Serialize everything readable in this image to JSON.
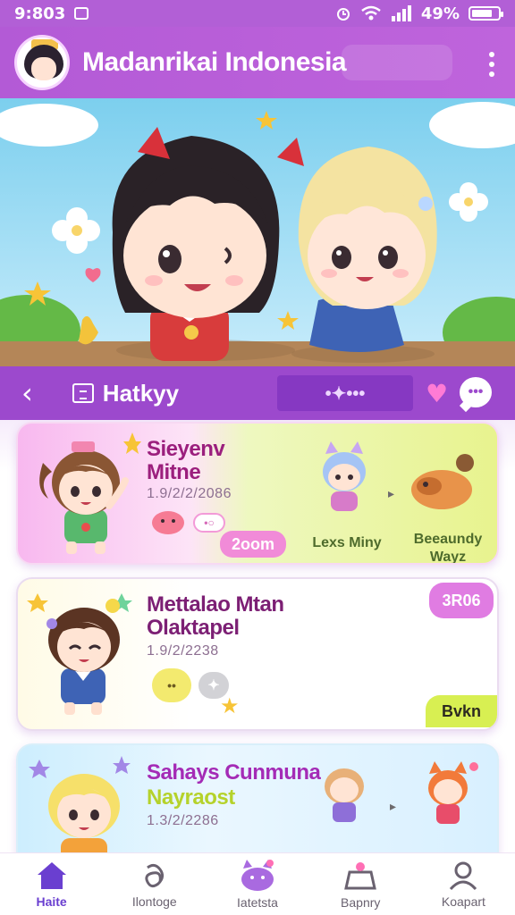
{
  "status_bar": {
    "time": "9:803",
    "battery": "49%"
  },
  "header": {
    "title": "Madanrikai Indonesia"
  },
  "nav_strip": {
    "back_icon": "chevron-left-icon",
    "tab_label": "Hatkyy",
    "pill_text": "•✦•••"
  },
  "cards": [
    {
      "title_line1": "Sieyenv",
      "title_line2": "Mitne",
      "date": "1.9/2/2/2086",
      "pill": "2oom",
      "item_a_label": "Lexs Miny",
      "item_b_label_line1": "Beeaundy",
      "item_b_label_line2": "Wayz"
    },
    {
      "title_line1": "Mettalao Mtan",
      "title_line2": "Olaktapel",
      "date": "1.9/2/2238",
      "badge": "3R06",
      "pill": "Bvkn"
    },
    {
      "title_line1": "Sahays Cunmuna",
      "title_line2": "Nayraost",
      "date": "1.3/2/2286"
    }
  ],
  "bottom_nav": [
    {
      "label": "Haite",
      "icon": "home-icon"
    },
    {
      "label": "Ilontoge",
      "icon": "loop-icon"
    },
    {
      "label": "Iatetsta",
      "icon": "cat-icon"
    },
    {
      "label": "Bapnry",
      "icon": "gift-icon"
    },
    {
      "label": "Koapart",
      "icon": "profile-icon"
    }
  ],
  "colors": {
    "header": "#b35ad6",
    "nav_strip": "#9c49cd",
    "accent_pink": "#f18bd8",
    "accent_lime": "#d8ef52",
    "active_tab": "#6a3fd0"
  }
}
